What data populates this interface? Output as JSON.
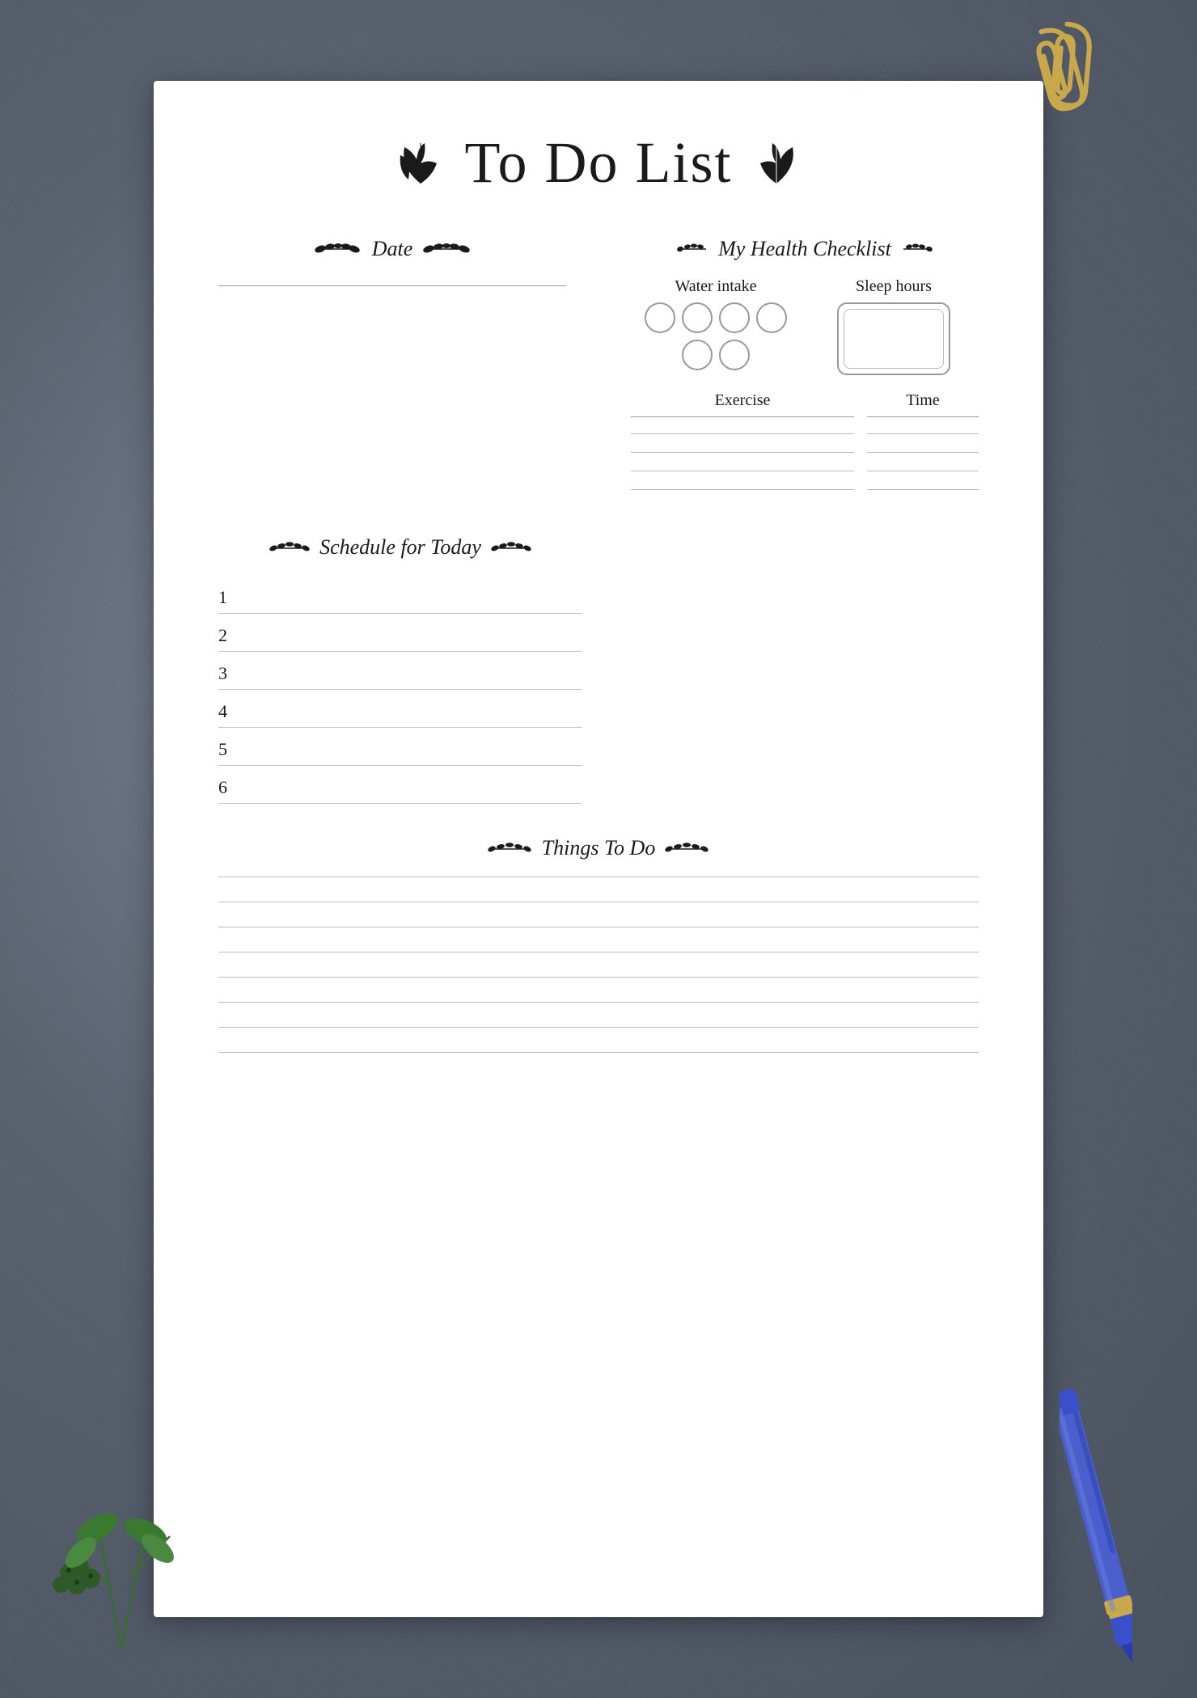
{
  "page": {
    "title": "To Do List",
    "background_color": "#6b7280",
    "paper_color": "#ffffff"
  },
  "date_section": {
    "header": "Date"
  },
  "health_section": {
    "header": "My Health Checklist",
    "water_label": "Water intake",
    "sleep_label": "Sleep hours",
    "exercise_label": "Exercise",
    "time_label": "Time",
    "water_circles": 6,
    "exercise_rows": 4
  },
  "schedule_section": {
    "header": "Schedule for Today",
    "items": [
      {
        "num": "1"
      },
      {
        "num": "2"
      },
      {
        "num": "3"
      },
      {
        "num": "4"
      },
      {
        "num": "5"
      },
      {
        "num": "6"
      }
    ]
  },
  "things_section": {
    "header": "Things To Do",
    "lines": 8
  },
  "leaf_glyph": "❧",
  "leaf_glyph_small": "❧"
}
